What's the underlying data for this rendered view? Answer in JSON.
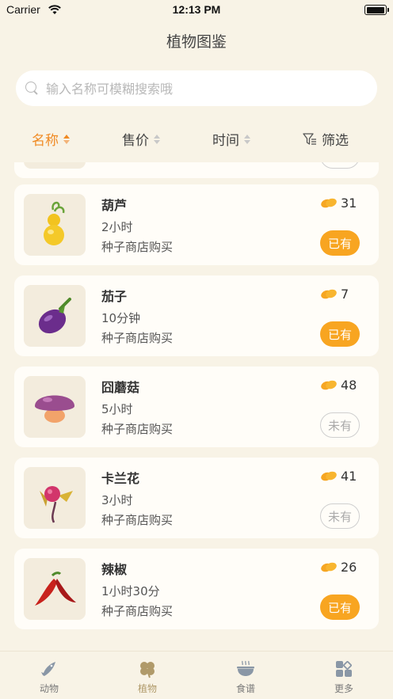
{
  "status": {
    "carrier": "Carrier",
    "time": "12:13 PM"
  },
  "header": {
    "title": "植物图鉴"
  },
  "search": {
    "placeholder": "输入名称可模糊搜索哦"
  },
  "sort": {
    "name": "名称",
    "price": "售价",
    "time": "时间",
    "filter": "筛选"
  },
  "plants": [
    {
      "name": "葫芦",
      "time": "2小时",
      "source": "种子商店购买",
      "price": "31",
      "owned": "已有"
    },
    {
      "name": "茄子",
      "time": "10分钟",
      "source": "种子商店购买",
      "price": "7",
      "owned": "已有"
    },
    {
      "name": "囧蘑菇",
      "time": "5小时",
      "source": "种子商店购买",
      "price": "48",
      "owned": "未有"
    },
    {
      "name": "卡兰花",
      "time": "3小时",
      "source": "种子商店购买",
      "price": "41",
      "owned": "未有"
    },
    {
      "name": "辣椒",
      "time": "1小时30分",
      "source": "种子商店购买",
      "price": "26",
      "owned": "已有"
    }
  ],
  "tabs": [
    {
      "label": "动物",
      "icon": "fish-icon"
    },
    {
      "label": "植物",
      "icon": "clover-icon"
    },
    {
      "label": "食谱",
      "icon": "bowl-icon"
    },
    {
      "label": "更多",
      "icon": "grid-icon"
    }
  ],
  "colors": {
    "accent": "#f08a23",
    "badge": "#f8a521",
    "background": "#f8f3e6"
  }
}
